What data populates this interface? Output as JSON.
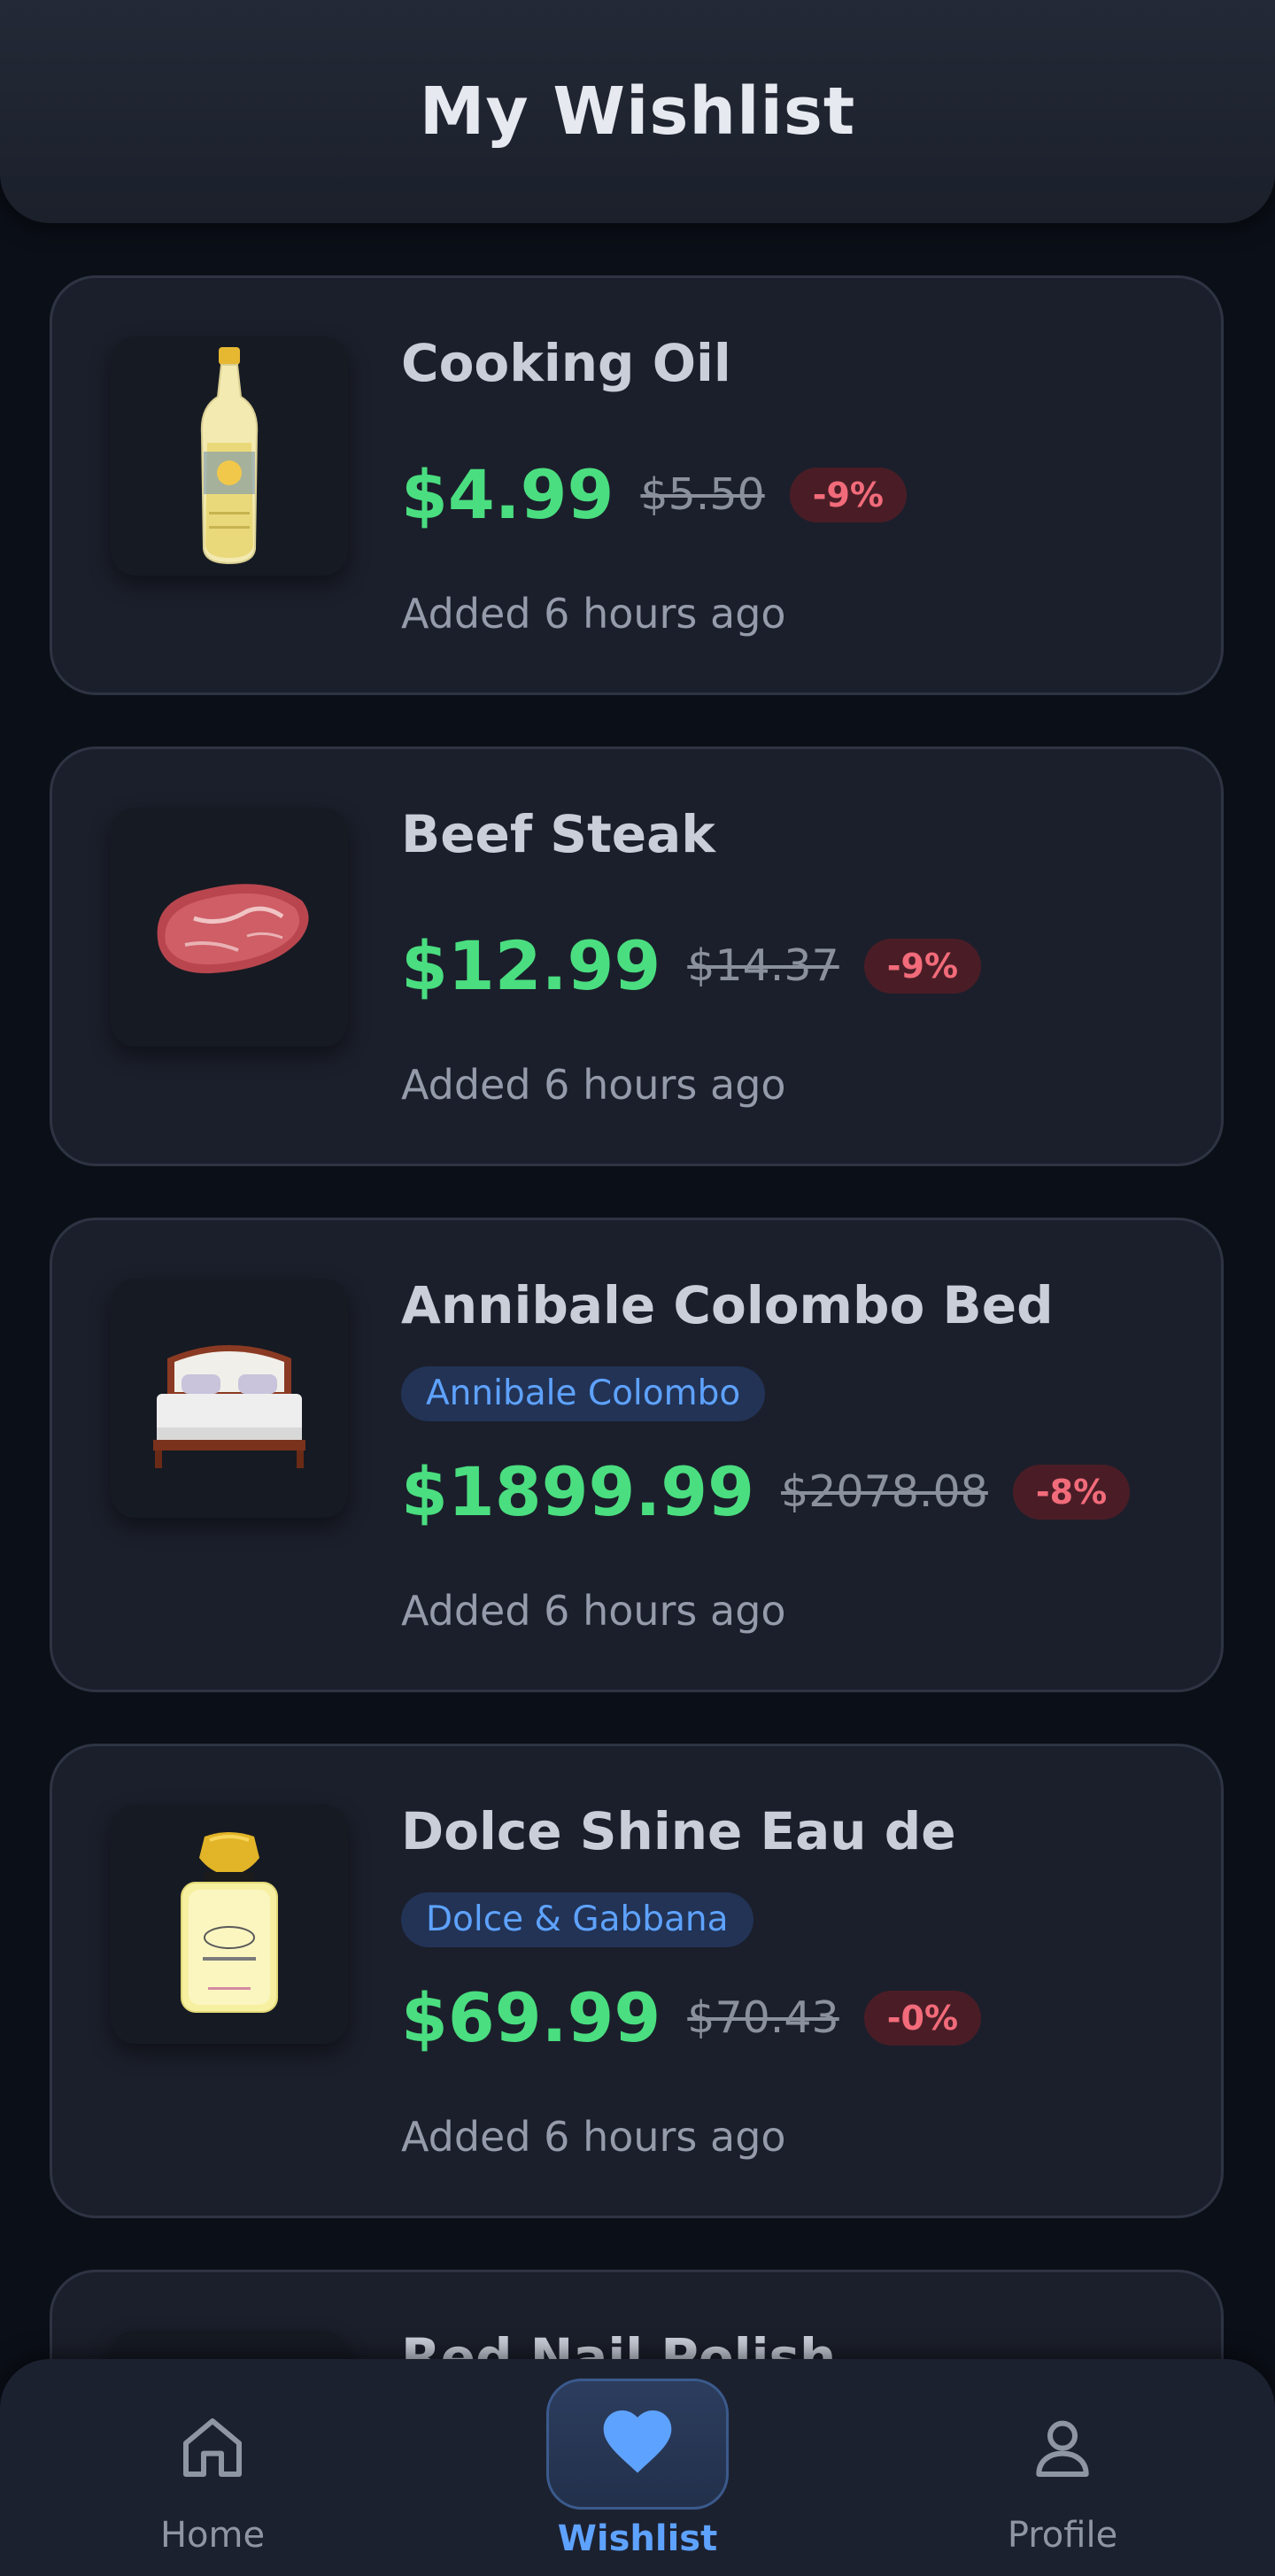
{
  "header": {
    "title": "My Wishlist"
  },
  "items": [
    {
      "name": "Cooking Oil",
      "brand": "",
      "price": "$4.99",
      "old_price": "$5.50",
      "discount": "-9%",
      "added": "Added 6 hours ago",
      "image": "cooking-oil-image"
    },
    {
      "name": "Beef Steak",
      "brand": "",
      "price": "$12.99",
      "old_price": "$14.37",
      "discount": "-9%",
      "added": "Added 6 hours ago",
      "image": "beef-steak-image"
    },
    {
      "name": "Annibale Colombo Bed",
      "brand": "Annibale Colombo",
      "price": "$1899.99",
      "old_price": "$2078.08",
      "discount": "-8%",
      "added": "Added 6 hours ago",
      "image": "bed-image"
    },
    {
      "name": "Dolce Shine Eau de",
      "brand": "Dolce & Gabbana",
      "price": "$69.99",
      "old_price": "$70.43",
      "discount": "-0%",
      "added": "Added 6 hours ago",
      "image": "perfume-image"
    },
    {
      "name": "Red Nail Polish",
      "brand": "",
      "price": "",
      "old_price": "",
      "discount": "",
      "added": "",
      "image": "nail-polish-image"
    }
  ],
  "nav": {
    "home": {
      "label": "Home",
      "icon": "home-icon"
    },
    "wishlist": {
      "label": "Wishlist",
      "icon": "heart-icon"
    },
    "profile": {
      "label": "Profile",
      "icon": "user-icon"
    }
  },
  "colors": {
    "background": "#0b0f17",
    "card": "#1b1f2b",
    "price": "#4ade80",
    "accent": "#5ea2ff",
    "discount_text": "#f26b7a",
    "discount_bg": "#4a1d26"
  }
}
